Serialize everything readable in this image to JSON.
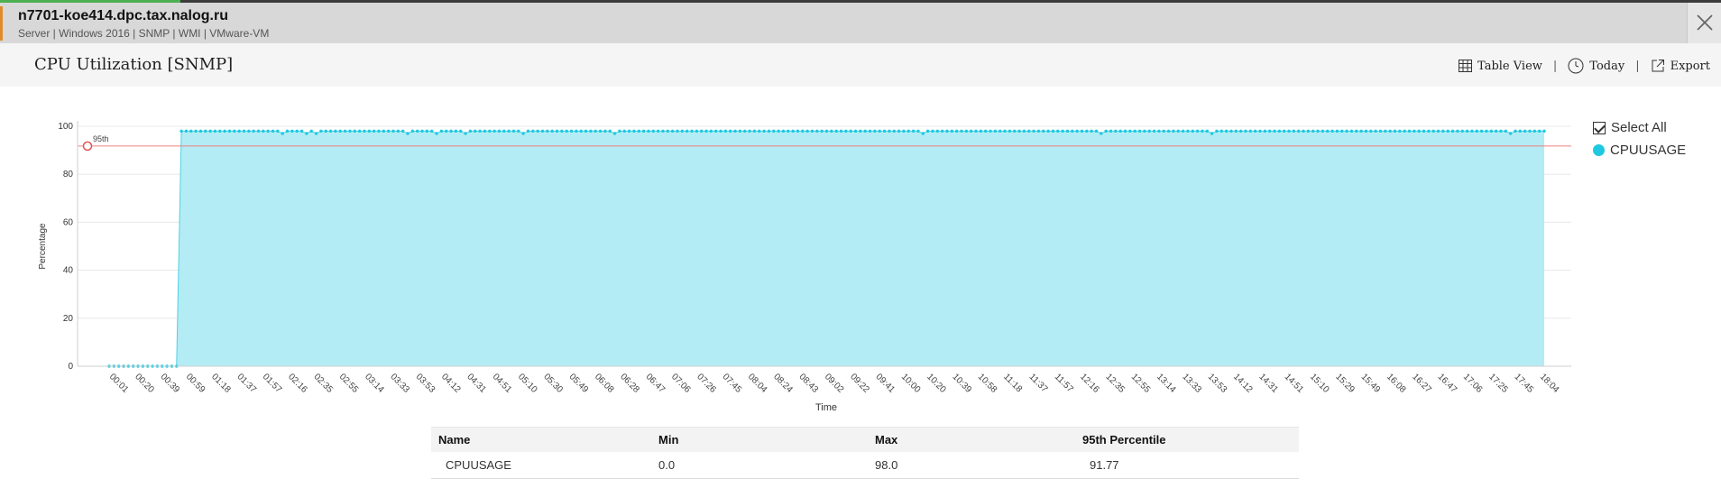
{
  "header": {
    "host": "n7701-koe414.dpc.tax.nalog.ru",
    "tags": "Server | Windows 2016  | SNMP  | WMI  | VMware-VM"
  },
  "page": {
    "title": "CPU Utilization [SNMP]"
  },
  "toolbar": {
    "table_view": "Table View",
    "today": "Today",
    "export": "Export",
    "separator": "|"
  },
  "colors": {
    "series": "#1ec8e0",
    "area": "#b3ecf4",
    "threshold": "#f08080"
  },
  "legend": {
    "select_all": "Select All",
    "series_name": "CPUUSAGE"
  },
  "chart_data": {
    "type": "area",
    "title": "",
    "xlabel": "Time",
    "ylabel": "Percentage",
    "ylim": [
      0,
      100
    ],
    "yticks": [
      0,
      20,
      40,
      60,
      80,
      100
    ],
    "grid": true,
    "legend_position": "right",
    "threshold": {
      "label": "95th",
      "value": 91.77
    },
    "x_tick_labels": [
      "00:01",
      "00:20",
      "00:39",
      "00:59",
      "01:18",
      "01:37",
      "01:57",
      "02:16",
      "02:35",
      "02:55",
      "03:14",
      "03:33",
      "03:53",
      "04:12",
      "04:31",
      "04:51",
      "05:10",
      "05:30",
      "05:49",
      "06:08",
      "06:28",
      "06:47",
      "07:06",
      "07:26",
      "07:45",
      "08:04",
      "08:24",
      "08:43",
      "09:02",
      "09:22",
      "09:41",
      "10:00",
      "10:20",
      "10:39",
      "10:58",
      "11:18",
      "11:37",
      "11:57",
      "12:16",
      "12:35",
      "12:55",
      "13:14",
      "13:33",
      "13:53",
      "14:12",
      "14:31",
      "14:51",
      "15:10",
      "15:29",
      "15:49",
      "16:08",
      "16:27",
      "16:47",
      "17:06",
      "17:25",
      "17:45",
      "18:04"
    ],
    "series": [
      {
        "name": "CPUUSAGE",
        "values": [
          0,
          0,
          0,
          0,
          0,
          0,
          0,
          0,
          0,
          0,
          0,
          0,
          0,
          0,
          0,
          98,
          98,
          98,
          98,
          98,
          98,
          98,
          98,
          98,
          98,
          98,
          98,
          98,
          98,
          98,
          98,
          98,
          98,
          98,
          98,
          98,
          97,
          98,
          98,
          98,
          98,
          97,
          98,
          97,
          98,
          98,
          98,
          98,
          98,
          98,
          98,
          98,
          98,
          98,
          98,
          98,
          98,
          98,
          98,
          98,
          98,
          98,
          97,
          98,
          98,
          98,
          98,
          98,
          97,
          98,
          98,
          98,
          98,
          98,
          97,
          98,
          98,
          98,
          98,
          98,
          98,
          98,
          98,
          98,
          98,
          98,
          97,
          98,
          98,
          98,
          98,
          98,
          98,
          98,
          98,
          98,
          98,
          98,
          98,
          98,
          98,
          98,
          98,
          98,
          98,
          97,
          98,
          98,
          98,
          98,
          98,
          98,
          98,
          98,
          98,
          98,
          98,
          98,
          98,
          98,
          98,
          98,
          98,
          98,
          98,
          98,
          98,
          98,
          98,
          98,
          98,
          98,
          98,
          98,
          98,
          98,
          98,
          98,
          98,
          98,
          98,
          98,
          98,
          98,
          98,
          98,
          98,
          98,
          98,
          98,
          98,
          98,
          98,
          98,
          98,
          98,
          98,
          98,
          98,
          98,
          98,
          98,
          98,
          98,
          98,
          98,
          98,
          98,
          98,
          97,
          98,
          98,
          98,
          98,
          98,
          98,
          98,
          98,
          98,
          98,
          98,
          98,
          98,
          98,
          98,
          98,
          98,
          98,
          98,
          98,
          98,
          98,
          98,
          98,
          98,
          98,
          98,
          98,
          98,
          98,
          98,
          98,
          98,
          98,
          98,
          98,
          97,
          98,
          98,
          98,
          98,
          98,
          98,
          98,
          98,
          98,
          98,
          98,
          98,
          98,
          98,
          98,
          98,
          98,
          98,
          98,
          98,
          98,
          98,
          97,
          98,
          98,
          98,
          98,
          98,
          98,
          98,
          98,
          98,
          98,
          98,
          98,
          98,
          98,
          98,
          98,
          98,
          98,
          98,
          98,
          98,
          98,
          98,
          98,
          98,
          98,
          98,
          98,
          98,
          98,
          98,
          98,
          98,
          98,
          98,
          98,
          98,
          98,
          98,
          98,
          98,
          98,
          98,
          98,
          98,
          98,
          98,
          98,
          98,
          98,
          98,
          98,
          98,
          98,
          98,
          98,
          98,
          98,
          98,
          98,
          98,
          97,
          98,
          98,
          98,
          98,
          98,
          98,
          98
        ]
      }
    ]
  },
  "summary": {
    "headers": [
      "Name",
      "Min",
      "Max",
      "95th Percentile"
    ],
    "rows": [
      [
        "CPUUSAGE",
        "0.0",
        "98.0",
        "91.77"
      ]
    ]
  }
}
